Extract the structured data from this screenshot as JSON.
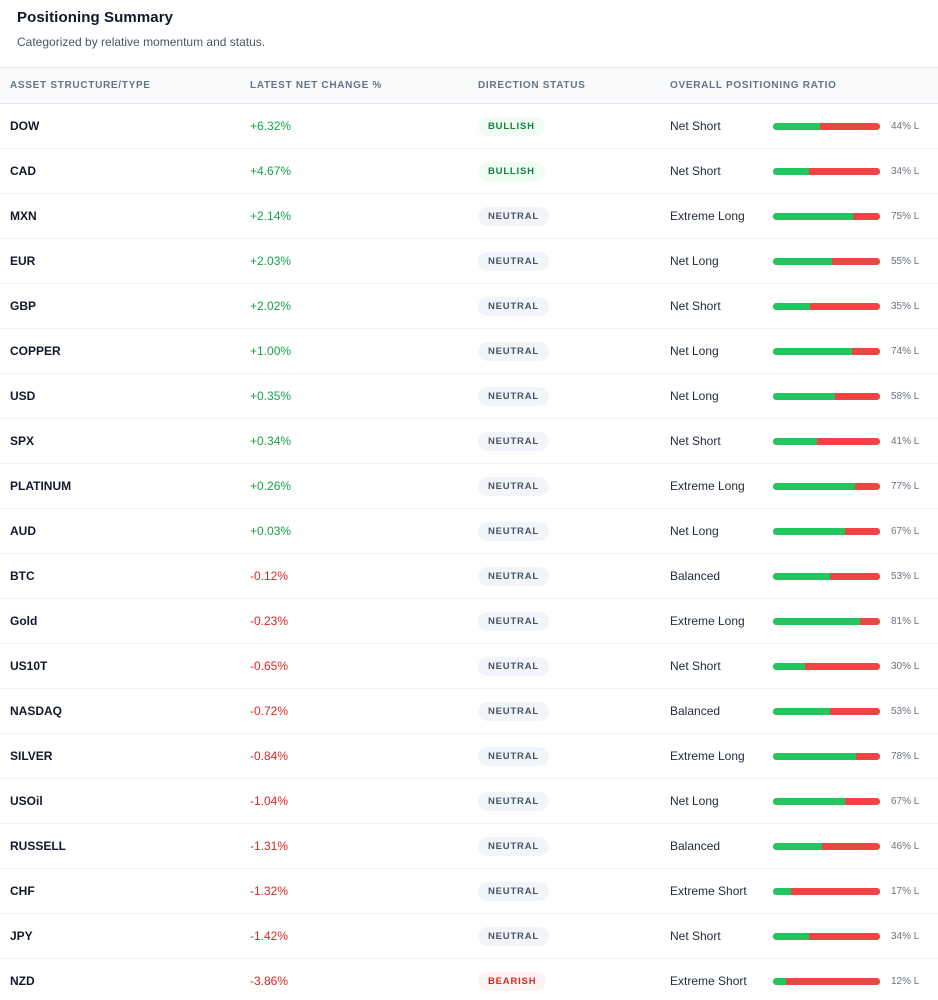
{
  "header": {
    "title": "Positioning Summary",
    "subtitle": "Categorized by relative momentum and status."
  },
  "columns": {
    "asset": "ASSET STRUCTURE/TYPE",
    "change": "LATEST NET CHANGE %",
    "status": "DIRECTION STATUS",
    "ratio": "OVERALL POSITIONING RATIO"
  },
  "colors": {
    "positive": "#16a34a",
    "negative": "#dc2626",
    "long_bar": "#22c55e",
    "short_bar": "#ef4444"
  },
  "rows": [
    {
      "asset": "DOW",
      "change": "+6.32%",
      "direction": "positive",
      "status": "BULLISH",
      "label": "Net Short",
      "long_pct": 44,
      "pct_text": "44% L"
    },
    {
      "asset": "CAD",
      "change": "+4.67%",
      "direction": "positive",
      "status": "BULLISH",
      "label": "Net Short",
      "long_pct": 34,
      "pct_text": "34% L"
    },
    {
      "asset": "MXN",
      "change": "+2.14%",
      "direction": "positive",
      "status": "NEUTRAL",
      "label": "Extreme Long",
      "long_pct": 75,
      "pct_text": "75% L"
    },
    {
      "asset": "EUR",
      "change": "+2.03%",
      "direction": "positive",
      "status": "NEUTRAL",
      "label": "Net Long",
      "long_pct": 55,
      "pct_text": "55% L"
    },
    {
      "asset": "GBP",
      "change": "+2.02%",
      "direction": "positive",
      "status": "NEUTRAL",
      "label": "Net Short",
      "long_pct": 35,
      "pct_text": "35% L"
    },
    {
      "asset": "COPPER",
      "change": "+1.00%",
      "direction": "positive",
      "status": "NEUTRAL",
      "label": "Net Long",
      "long_pct": 74,
      "pct_text": "74% L"
    },
    {
      "asset": "USD",
      "change": "+0.35%",
      "direction": "positive",
      "status": "NEUTRAL",
      "label": "Net Long",
      "long_pct": 58,
      "pct_text": "58% L"
    },
    {
      "asset": "SPX",
      "change": "+0.34%",
      "direction": "positive",
      "status": "NEUTRAL",
      "label": "Net Short",
      "long_pct": 41,
      "pct_text": "41% L"
    },
    {
      "asset": "PLATINUM",
      "change": "+0.26%",
      "direction": "positive",
      "status": "NEUTRAL",
      "label": "Extreme Long",
      "long_pct": 77,
      "pct_text": "77% L"
    },
    {
      "asset": "AUD",
      "change": "+0.03%",
      "direction": "positive",
      "status": "NEUTRAL",
      "label": "Net Long",
      "long_pct": 67,
      "pct_text": "67% L"
    },
    {
      "asset": "BTC",
      "change": "-0.12%",
      "direction": "negative",
      "status": "NEUTRAL",
      "label": "Balanced",
      "long_pct": 53,
      "pct_text": "53% L"
    },
    {
      "asset": "Gold",
      "change": "-0.23%",
      "direction": "negative",
      "status": "NEUTRAL",
      "label": "Extreme Long",
      "long_pct": 81,
      "pct_text": "81% L"
    },
    {
      "asset": "US10T",
      "change": "-0.65%",
      "direction": "negative",
      "status": "NEUTRAL",
      "label": "Net Short",
      "long_pct": 30,
      "pct_text": "30% L"
    },
    {
      "asset": "NASDAQ",
      "change": "-0.72%",
      "direction": "negative",
      "status": "NEUTRAL",
      "label": "Balanced",
      "long_pct": 53,
      "pct_text": "53% L"
    },
    {
      "asset": "SILVER",
      "change": "-0.84%",
      "direction": "negative",
      "status": "NEUTRAL",
      "label": "Extreme Long",
      "long_pct": 78,
      "pct_text": "78% L"
    },
    {
      "asset": "USOil",
      "change": "-1.04%",
      "direction": "negative",
      "status": "NEUTRAL",
      "label": "Net Long",
      "long_pct": 67,
      "pct_text": "67% L"
    },
    {
      "asset": "RUSSELL",
      "change": "-1.31%",
      "direction": "negative",
      "status": "NEUTRAL",
      "label": "Balanced",
      "long_pct": 46,
      "pct_text": "46% L"
    },
    {
      "asset": "CHF",
      "change": "-1.32%",
      "direction": "negative",
      "status": "NEUTRAL",
      "label": "Extreme Short",
      "long_pct": 17,
      "pct_text": "17% L"
    },
    {
      "asset": "JPY",
      "change": "-1.42%",
      "direction": "negative",
      "status": "NEUTRAL",
      "label": "Net Short",
      "long_pct": 34,
      "pct_text": "34% L"
    },
    {
      "asset": "NZD",
      "change": "-3.86%",
      "direction": "negative",
      "status": "BEARISH",
      "label": "Extreme Short",
      "long_pct": 12,
      "pct_text": "12% L"
    }
  ]
}
